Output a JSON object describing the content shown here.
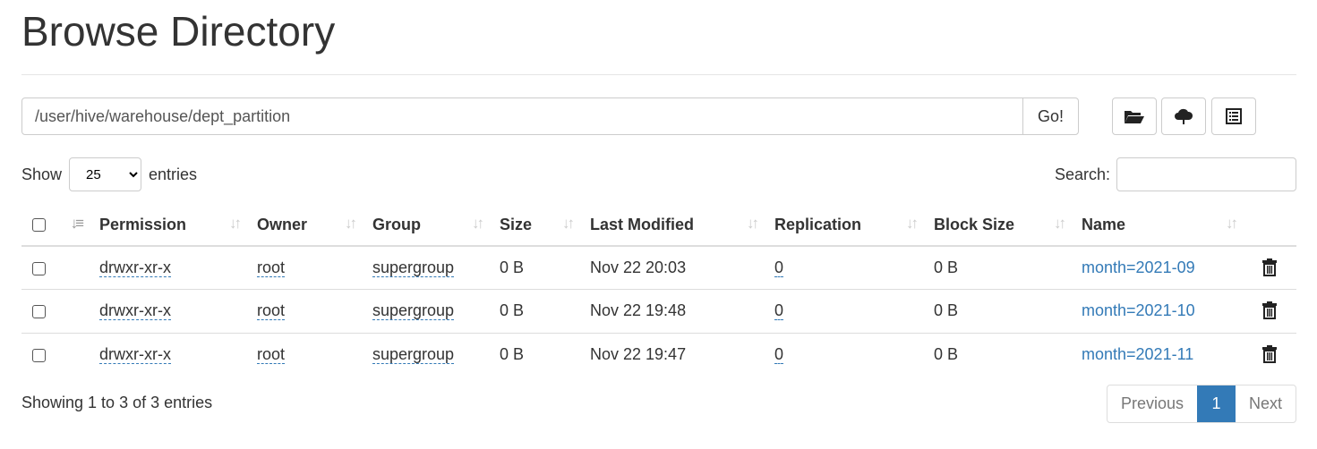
{
  "title": "Browse Directory",
  "path": {
    "value": "/user/hive/warehouse/dept_partition",
    "go_label": "Go!"
  },
  "toolbar": {
    "icons": [
      "folder-open-icon",
      "cloud-upload-icon",
      "list-icon"
    ]
  },
  "length": {
    "show_label": "Show",
    "value": "25",
    "entries_label": "entries"
  },
  "search": {
    "label": "Search:",
    "value": ""
  },
  "table": {
    "headers": [
      "Permission",
      "Owner",
      "Group",
      "Size",
      "Last Modified",
      "Replication",
      "Block Size",
      "Name"
    ],
    "rows": [
      {
        "permission": "drwxr-xr-x",
        "owner": "root",
        "group": "supergroup",
        "size": "0 B",
        "modified": "Nov 22 20:03",
        "replication": "0",
        "block_size": "0 B",
        "name": "month=2021-09"
      },
      {
        "permission": "drwxr-xr-x",
        "owner": "root",
        "group": "supergroup",
        "size": "0 B",
        "modified": "Nov 22 19:48",
        "replication": "0",
        "block_size": "0 B",
        "name": "month=2021-10"
      },
      {
        "permission": "drwxr-xr-x",
        "owner": "root",
        "group": "supergroup",
        "size": "0 B",
        "modified": "Nov 22 19:47",
        "replication": "0",
        "block_size": "0 B",
        "name": "month=2021-11"
      }
    ]
  },
  "footer": {
    "info": "Showing 1 to 3 of 3 entries",
    "previous": "Previous",
    "page": "1",
    "next": "Next"
  },
  "colors": {
    "link": "#337ab7",
    "active_page": "#337ab7"
  }
}
